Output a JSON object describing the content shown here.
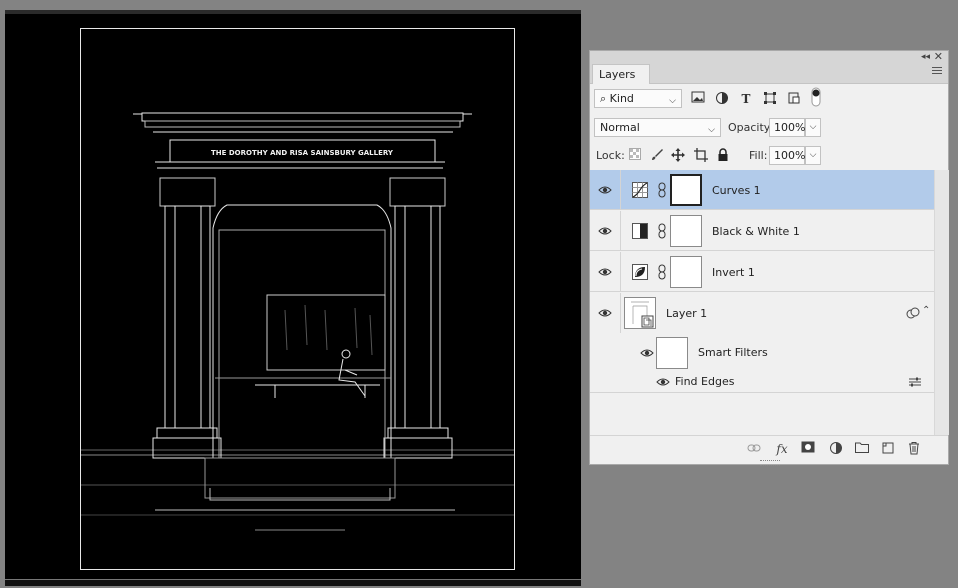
{
  "canvas": {
    "sign_text": "THE DOROTHY AND RISA SAINSBURY GALLERY"
  },
  "panel": {
    "tab_label": "Layers",
    "filter": {
      "label": "Kind",
      "icon": "search-icon"
    },
    "blend_mode": "Normal",
    "opacity_label": "Opacity:",
    "opacity_value": "100%",
    "lock_label": "Lock:",
    "fill_label": "Fill:",
    "fill_value": "100%",
    "layers": [
      {
        "name": "Curves 1",
        "type": "curves-adjustment-icon",
        "selected": true
      },
      {
        "name": "Black & White 1",
        "type": "black-white-adjustment-icon",
        "selected": false
      },
      {
        "name": "Invert 1",
        "type": "invert-adjustment-icon",
        "selected": false
      },
      {
        "name": "Layer 1",
        "type": "smart-object",
        "selected": false
      }
    ],
    "smart_filters_label": "Smart Filters",
    "find_edges_label": "Find Edges",
    "selection_color": "#b2cbea"
  }
}
